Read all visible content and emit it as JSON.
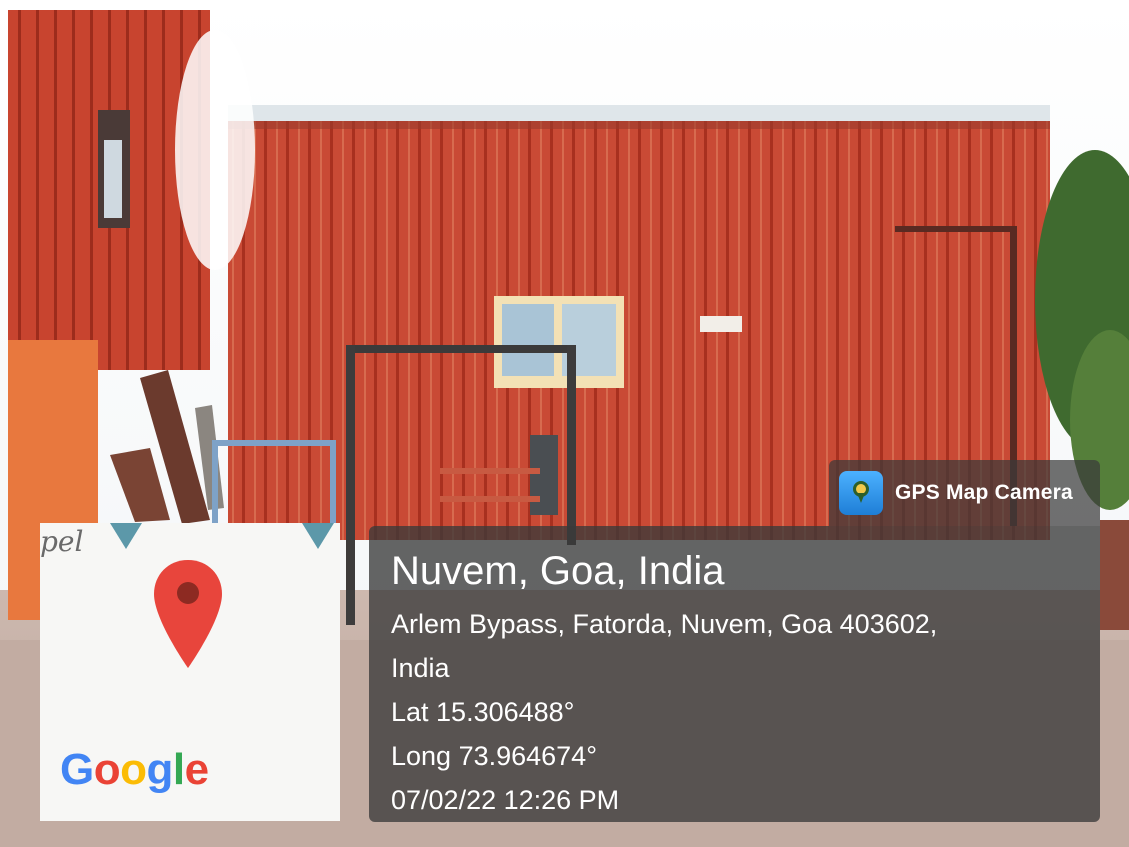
{
  "overlay": {
    "app_name": "GPS Map Camera",
    "icon": "gps-map-camera-icon",
    "title": "Nuvem, Goa, India",
    "address_line1": "Arlem Bypass, Fatorda, Nuvem, Goa 403602,",
    "address_line2": "India",
    "latitude": "Lat 15.306488°",
    "longitude": "Long 73.964674°",
    "datetime": "07/02/22 12:26 PM"
  },
  "map": {
    "partial_label": "pel",
    "brand_letters": [
      "G",
      "o",
      "o",
      "g",
      "l",
      "e"
    ],
    "brand_colors": [
      "#4285F4",
      "#EA4335",
      "#FBBC05",
      "#4285F4",
      "#34A853",
      "#EA4335"
    ],
    "pin_icon": "location-pin-icon",
    "pin_color": "#E8453C"
  },
  "colors": {
    "shed_wall": "#c9412f",
    "panel_bg": "#3a3a3a"
  }
}
